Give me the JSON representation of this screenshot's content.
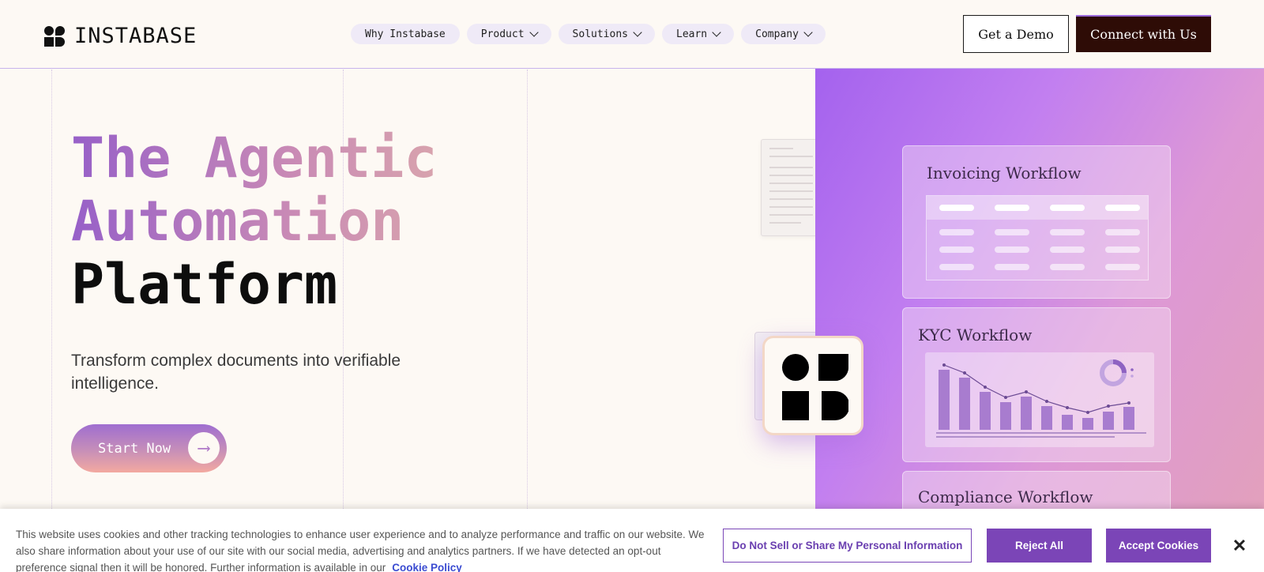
{
  "brand": {
    "name": "INSTABASE"
  },
  "nav": {
    "items": [
      {
        "label": "Why Instabase",
        "has_dropdown": false
      },
      {
        "label": "Product",
        "has_dropdown": true
      },
      {
        "label": "Solutions",
        "has_dropdown": true
      },
      {
        "label": "Learn",
        "has_dropdown": true
      },
      {
        "label": "Company",
        "has_dropdown": true
      }
    ]
  },
  "header_actions": {
    "demo_label": "Get a Demo",
    "connect_label": "Connect with Us"
  },
  "hero": {
    "title_line1": "The Agentic",
    "title_line2": "Automation",
    "title_line3": "Platform",
    "subtitle": "Transform complex documents into verifiable intelligence.",
    "cta_label": "Start Now",
    "cta_icon": "arrow-right-icon"
  },
  "workflow_cards": [
    {
      "title": "Invoicing Workflow"
    },
    {
      "title": "KYC Workflow"
    },
    {
      "title": "Compliance Workflow"
    }
  ],
  "cookie_banner": {
    "text": "This website uses cookies and other tracking technologies to enhance user experience and to analyze performance and traffic on our website. We also share information about your use of our site with our social media, advertising and analytics partners. If we have detected an opt-out preference signal then it will be honored. Further information is available in our",
    "link_label": "Cookie Policy",
    "do_not_sell_label": "Do Not Sell or Share My Personal Information",
    "reject_label": "Reject All",
    "accept_label": "Accept Cookies",
    "close_icon": "close-icon"
  },
  "colors": {
    "accent_purple": "#7b45b7",
    "connect_bg": "#2e0c06",
    "page_bg": "#fdf9f4"
  }
}
